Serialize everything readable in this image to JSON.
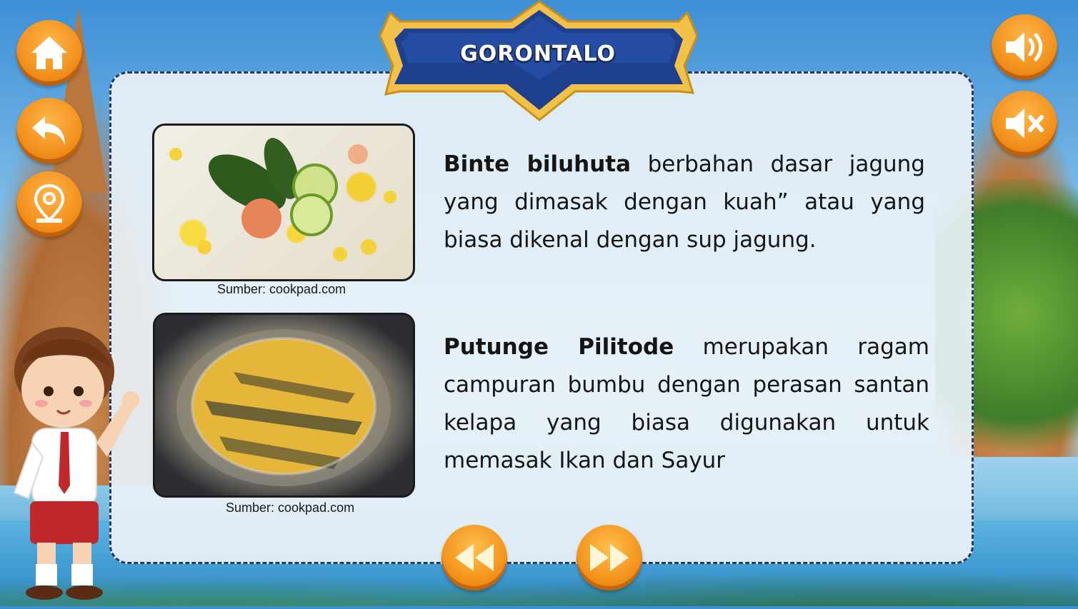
{
  "title": "GORONTALO",
  "colors": {
    "accent_orange": "#f2901c",
    "banner_blue": "#1f3f8f",
    "banner_gold": "#f2c14a",
    "panel_border": "#233b6b"
  },
  "left_buttons": [
    {
      "name": "home",
      "icon": "home-icon"
    },
    {
      "name": "back",
      "icon": "back-arrow-icon"
    },
    {
      "name": "map",
      "icon": "map-pin-icon"
    }
  ],
  "right_buttons": [
    {
      "name": "sound-on",
      "icon": "speaker-on-icon"
    },
    {
      "name": "sound-off",
      "icon": "speaker-mute-icon"
    }
  ],
  "foods": [
    {
      "name": "Binte biluhuta",
      "description": " berbahan dasar jagung yang dimasak dengan kuah” atau yang biasa dikenal dengan sup jagung.",
      "caption": "Sumber:  cookpad.com"
    },
    {
      "name": "Putunge Pilitode",
      "description": " merupakan ragam campuran bumbu dengan perasan santan kelapa yang biasa digunakan untuk memasak Ikan dan Sayur",
      "caption": "Sumber:  cookpad.com"
    }
  ],
  "nav": {
    "prev_icon": "rewind-icon",
    "next_icon": "fast-forward-icon"
  }
}
